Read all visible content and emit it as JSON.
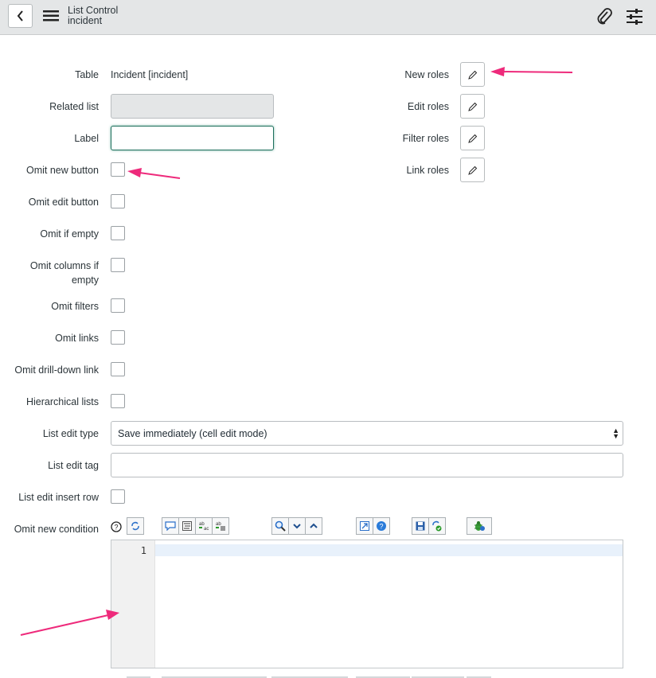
{
  "header": {
    "title": "List Control",
    "subtitle": "incident",
    "back_icon": "chevron-left-icon",
    "menu_icon": "hamburger-icon",
    "attachment_icon": "paperclip-icon",
    "settings_icon": "sliders-icon"
  },
  "form": {
    "table_label": "Table",
    "table_value": "Incident [incident]",
    "related_list_label": "Related list",
    "label_label": "Label",
    "label_value": "",
    "omit_new_button_label": "Omit new button",
    "omit_edit_button_label": "Omit edit button",
    "omit_if_empty_label": "Omit if empty",
    "omit_columns_label_1": "Omit columns if",
    "omit_columns_label_2": "empty",
    "omit_filters_label": "Omit filters",
    "omit_links_label": "Omit links",
    "omit_drilldown_label": "Omit drill-down link",
    "hierarchical_lists_label": "Hierarchical lists",
    "list_edit_type_label": "List edit type",
    "list_edit_type_value": "Save immediately (cell edit mode)",
    "list_edit_tag_label": "List edit tag",
    "list_edit_tag_value": "",
    "list_edit_insert_row_label": "List edit insert row",
    "omit_new_condition_label": "Omit new condition"
  },
  "roles": {
    "new_roles_label": "New roles",
    "edit_roles_label": "Edit roles",
    "filter_roles_label": "Filter roles",
    "link_roles_label": "Link roles",
    "edit_icon": "pencil-icon"
  },
  "editor": {
    "line_number": "1",
    "toolbar_icons": [
      "comment-icon",
      "format-icon",
      "replace-icon",
      "replace-all-icon",
      "search-icon",
      "next-icon",
      "previous-icon",
      "fullscreen-icon",
      "help-icon",
      "save-icon",
      "script-check-icon",
      "debug-icon"
    ]
  },
  "colors": {
    "annotation": "#ee2a7b",
    "focus_border": "#1d6f5c",
    "header_bg": "#e4e6e7"
  }
}
